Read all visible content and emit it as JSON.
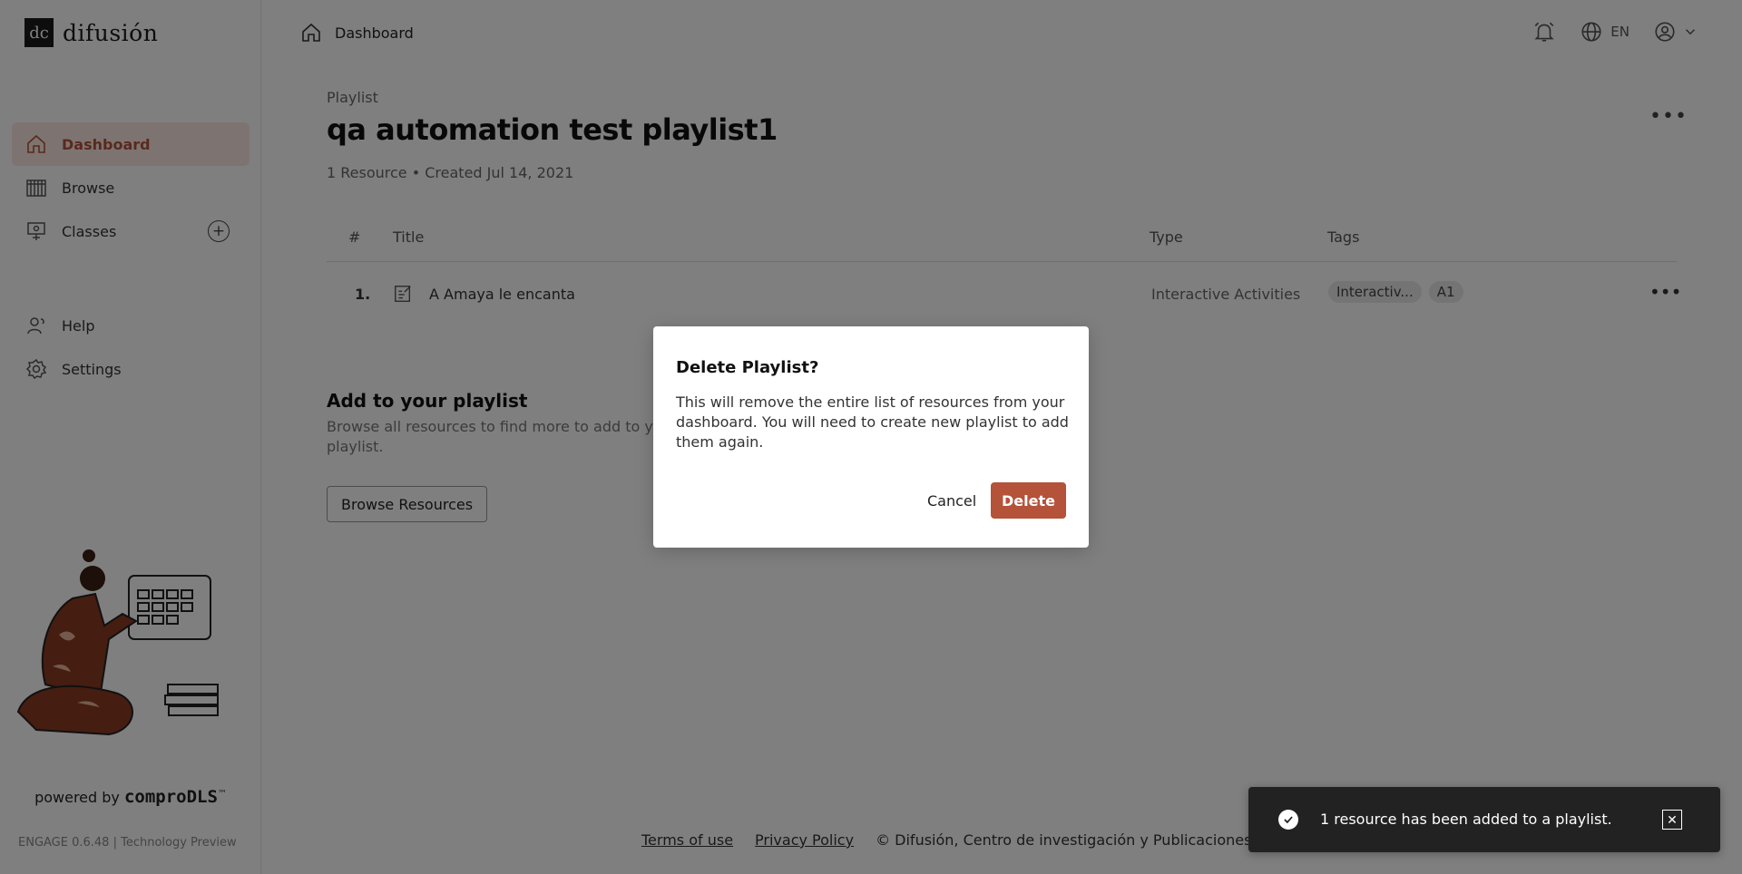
{
  "brand": {
    "logo_mark": "dc",
    "name": "difusión"
  },
  "sidebar": {
    "items": [
      {
        "label": "Dashboard",
        "icon": "home-icon"
      },
      {
        "label": "Browse",
        "icon": "library-icon"
      },
      {
        "label": "Classes",
        "icon": "classroom-icon"
      },
      {
        "label": "Help",
        "icon": "help-icon"
      },
      {
        "label": "Settings",
        "icon": "gear-icon"
      }
    ],
    "powered_by": "powered by",
    "powered_brand": "comproDLS",
    "trademark": "™",
    "version": "ENGAGE 0.6.48 | Technology Preview"
  },
  "header": {
    "breadcrumb": "Dashboard",
    "language": "EN"
  },
  "page": {
    "eyebrow": "Playlist",
    "title": "qa automation test playlist1",
    "meta": "1 Resource • Created Jul 14, 2021"
  },
  "table": {
    "headers": {
      "num": "#",
      "title": "Title",
      "type": "Type",
      "tags": "Tags"
    },
    "rows": [
      {
        "num": "1.",
        "title": "A Amaya le encanta",
        "type": "Interactive Activities",
        "tags": [
          "Interactiv...",
          "A1"
        ]
      }
    ]
  },
  "add_section": {
    "title": "Add to your playlist",
    "description": "Browse all resources to find more to add to your playlist.",
    "button": "Browse Resources"
  },
  "footer": {
    "terms": "Terms of use",
    "privacy": "Privacy Policy",
    "copyright": "© Difusión, Centro de investigación y Publicaciones de"
  },
  "modal": {
    "title": "Delete Playlist?",
    "body": "This will remove the entire list of resources from your dashboard. You will need to create new playlist to add them again.",
    "cancel": "Cancel",
    "confirm": "Delete"
  },
  "toast": {
    "message": "1 resource has been added to a playlist.",
    "close": "✕"
  },
  "colors": {
    "accent": "#b5523a",
    "active_bg": "#fbe9e2",
    "overlay": "rgba(0,0,0,0.5)"
  }
}
